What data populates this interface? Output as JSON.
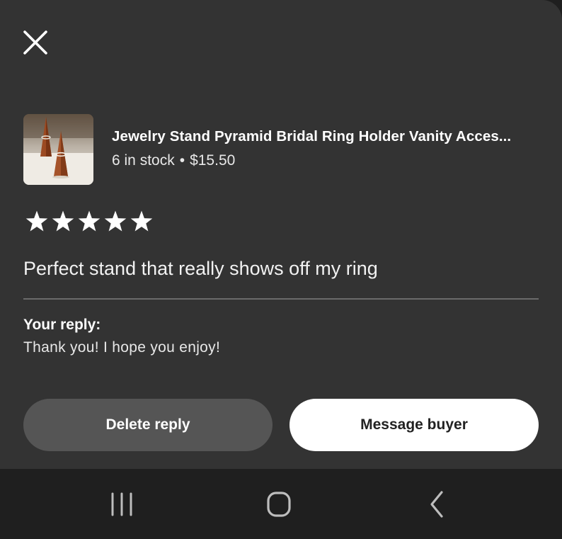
{
  "product": {
    "title": "Jewelry Stand Pyramid Bridal Ring Holder Vanity Acces...",
    "stock": "6 in stock",
    "separator": "•",
    "price": "$15.50",
    "thumbnail_icon": "ring-stand-photo"
  },
  "review": {
    "rating": 5,
    "rating_max": 5,
    "text": "Perfect stand that really shows off my ring"
  },
  "reply": {
    "label": "Your reply:",
    "text": "Thank you! I hope you enjoy!"
  },
  "actions": {
    "delete_label": "Delete reply",
    "message_label": "Message buyer"
  },
  "icons": {
    "close": "close-icon",
    "star": "star-icon",
    "recents": "recents-icon",
    "home": "home-icon",
    "back": "back-icon"
  },
  "colors": {
    "sheet_background": "#333333",
    "nav_background": "#1f1f1f",
    "delete_button": "#555555",
    "message_button": "#ffffff",
    "star": "#ffffff"
  }
}
